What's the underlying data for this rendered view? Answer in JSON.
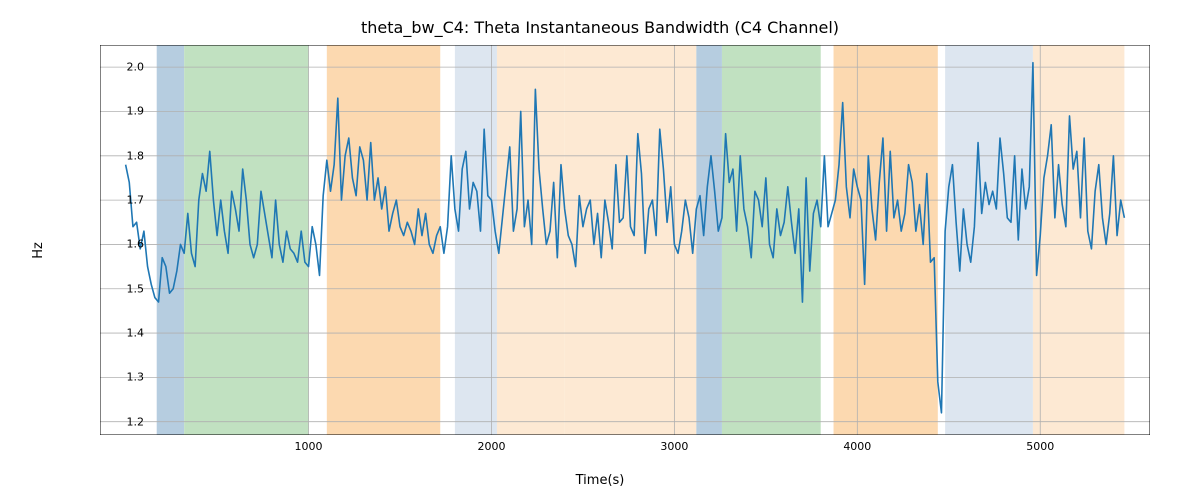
{
  "chart_data": {
    "type": "line",
    "title": "theta_bw_C4: Theta Instantaneous Bandwidth (C4 Channel)",
    "xlabel": "Time(s)",
    "ylabel": "Hz",
    "xlim": [
      -140,
      5600
    ],
    "ylim": [
      1.17,
      2.05
    ],
    "xticks": [
      1000,
      2000,
      3000,
      4000,
      5000
    ],
    "yticks": [
      1.2,
      1.3,
      1.4,
      1.5,
      1.6,
      1.7,
      1.8,
      1.9,
      2.0
    ],
    "bands": [
      {
        "x0": 170,
        "x1": 320,
        "color": "#b6cde0"
      },
      {
        "x0": 320,
        "x1": 1000,
        "color": "#c1e1c1"
      },
      {
        "x0": 1100,
        "x1": 1720,
        "color": "#fcd9b0"
      },
      {
        "x0": 1800,
        "x1": 2030,
        "color": "#dde6f0"
      },
      {
        "x0": 2030,
        "x1": 2400,
        "color": "#fde9d3"
      },
      {
        "x0": 2400,
        "x1": 3120,
        "color": "#fde9d3"
      },
      {
        "x0": 3120,
        "x1": 3260,
        "color": "#b6cde0"
      },
      {
        "x0": 3260,
        "x1": 3800,
        "color": "#c1e1c1"
      },
      {
        "x0": 3870,
        "x1": 4440,
        "color": "#fcd9b0"
      },
      {
        "x0": 4480,
        "x1": 4960,
        "color": "#dde6f0"
      },
      {
        "x0": 4960,
        "x1": 5460,
        "color": "#fde9d3"
      }
    ],
    "x": [
      0,
      20,
      40,
      60,
      80,
      100,
      120,
      140,
      160,
      180,
      200,
      220,
      240,
      260,
      280,
      300,
      320,
      340,
      360,
      380,
      400,
      420,
      440,
      460,
      480,
      500,
      520,
      540,
      560,
      580,
      600,
      620,
      640,
      660,
      680,
      700,
      720,
      740,
      760,
      780,
      800,
      820,
      840,
      860,
      880,
      900,
      920,
      940,
      960,
      980,
      1000,
      1020,
      1040,
      1060,
      1080,
      1100,
      1120,
      1140,
      1160,
      1180,
      1200,
      1220,
      1240,
      1260,
      1280,
      1300,
      1320,
      1340,
      1360,
      1380,
      1400,
      1420,
      1440,
      1460,
      1480,
      1500,
      1520,
      1540,
      1560,
      1580,
      1600,
      1620,
      1640,
      1660,
      1680,
      1700,
      1720,
      1740,
      1760,
      1780,
      1800,
      1820,
      1840,
      1860,
      1880,
      1900,
      1920,
      1940,
      1960,
      1980,
      2000,
      2020,
      2040,
      2060,
      2080,
      2100,
      2120,
      2140,
      2160,
      2180,
      2200,
      2220,
      2240,
      2260,
      2280,
      2300,
      2320,
      2340,
      2360,
      2380,
      2400,
      2420,
      2440,
      2460,
      2480,
      2500,
      2520,
      2540,
      2560,
      2580,
      2600,
      2620,
      2640,
      2660,
      2680,
      2700,
      2720,
      2740,
      2760,
      2780,
      2800,
      2820,
      2840,
      2860,
      2880,
      2900,
      2920,
      2940,
      2960,
      2980,
      3000,
      3020,
      3040,
      3060,
      3080,
      3100,
      3120,
      3140,
      3160,
      3180,
      3200,
      3220,
      3240,
      3260,
      3280,
      3300,
      3320,
      3340,
      3360,
      3380,
      3400,
      3420,
      3440,
      3460,
      3480,
      3500,
      3520,
      3540,
      3560,
      3580,
      3600,
      3620,
      3640,
      3660,
      3680,
      3700,
      3720,
      3740,
      3760,
      3780,
      3800,
      3820,
      3840,
      3860,
      3880,
      3900,
      3920,
      3940,
      3960,
      3980,
      4000,
      4020,
      4040,
      4060,
      4080,
      4100,
      4120,
      4140,
      4160,
      4180,
      4200,
      4220,
      4240,
      4260,
      4280,
      4300,
      4320,
      4340,
      4360,
      4380,
      4400,
      4420,
      4440,
      4460,
      4480,
      4500,
      4520,
      4540,
      4560,
      4580,
      4600,
      4620,
      4640,
      4660,
      4680,
      4700,
      4720,
      4740,
      4760,
      4780,
      4800,
      4820,
      4840,
      4860,
      4880,
      4900,
      4920,
      4940,
      4960,
      4980,
      5000,
      5020,
      5040,
      5060,
      5080,
      5100,
      5120,
      5140,
      5160,
      5180,
      5200,
      5220,
      5240,
      5260,
      5280,
      5300,
      5320,
      5340,
      5360,
      5380,
      5400,
      5420,
      5440,
      5460
    ],
    "values": [
      1.78,
      1.74,
      1.64,
      1.65,
      1.59,
      1.63,
      1.55,
      1.51,
      1.48,
      1.47,
      1.57,
      1.55,
      1.49,
      1.5,
      1.54,
      1.6,
      1.58,
      1.67,
      1.58,
      1.55,
      1.7,
      1.76,
      1.72,
      1.81,
      1.7,
      1.62,
      1.7,
      1.63,
      1.58,
      1.72,
      1.68,
      1.63,
      1.77,
      1.7,
      1.6,
      1.57,
      1.6,
      1.72,
      1.67,
      1.62,
      1.57,
      1.7,
      1.6,
      1.56,
      1.63,
      1.59,
      1.58,
      1.56,
      1.63,
      1.56,
      1.55,
      1.64,
      1.6,
      1.53,
      1.71,
      1.79,
      1.72,
      1.78,
      1.93,
      1.7,
      1.8,
      1.84,
      1.75,
      1.71,
      1.82,
      1.79,
      1.7,
      1.83,
      1.7,
      1.75,
      1.68,
      1.73,
      1.63,
      1.67,
      1.7,
      1.64,
      1.62,
      1.65,
      1.63,
      1.6,
      1.68,
      1.62,
      1.67,
      1.6,
      1.58,
      1.62,
      1.64,
      1.58,
      1.64,
      1.8,
      1.68,
      1.63,
      1.77,
      1.81,
      1.68,
      1.74,
      1.72,
      1.63,
      1.86,
      1.71,
      1.7,
      1.63,
      1.58,
      1.66,
      1.74,
      1.82,
      1.63,
      1.68,
      1.9,
      1.64,
      1.7,
      1.6,
      1.95,
      1.77,
      1.68,
      1.6,
      1.63,
      1.74,
      1.57,
      1.78,
      1.68,
      1.62,
      1.6,
      1.55,
      1.71,
      1.64,
      1.68,
      1.7,
      1.6,
      1.67,
      1.57,
      1.7,
      1.65,
      1.59,
      1.78,
      1.65,
      1.66,
      1.8,
      1.64,
      1.62,
      1.85,
      1.76,
      1.58,
      1.68,
      1.7,
      1.62,
      1.86,
      1.77,
      1.65,
      1.73,
      1.6,
      1.58,
      1.63,
      1.7,
      1.66,
      1.58,
      1.68,
      1.71,
      1.62,
      1.73,
      1.8,
      1.72,
      1.63,
      1.66,
      1.85,
      1.74,
      1.77,
      1.63,
      1.8,
      1.68,
      1.64,
      1.57,
      1.72,
      1.7,
      1.64,
      1.75,
      1.6,
      1.57,
      1.68,
      1.62,
      1.65,
      1.73,
      1.65,
      1.58,
      1.68,
      1.47,
      1.75,
      1.54,
      1.67,
      1.7,
      1.64,
      1.8,
      1.64,
      1.67,
      1.7,
      1.78,
      1.92,
      1.73,
      1.66,
      1.77,
      1.73,
      1.7,
      1.51,
      1.8,
      1.68,
      1.61,
      1.74,
      1.84,
      1.63,
      1.81,
      1.66,
      1.7,
      1.63,
      1.67,
      1.78,
      1.74,
      1.63,
      1.69,
      1.6,
      1.76,
      1.56,
      1.57,
      1.29,
      1.22,
      1.63,
      1.73,
      1.78,
      1.65,
      1.54,
      1.68,
      1.6,
      1.56,
      1.64,
      1.83,
      1.67,
      1.74,
      1.69,
      1.72,
      1.68,
      1.84,
      1.76,
      1.66,
      1.65,
      1.8,
      1.61,
      1.77,
      1.68,
      1.73,
      2.01,
      1.53,
      1.62,
      1.75,
      1.8,
      1.87,
      1.66,
      1.78,
      1.69,
      1.64,
      1.89,
      1.77,
      1.81,
      1.66,
      1.84,
      1.63,
      1.59,
      1.72,
      1.78,
      1.66,
      1.6,
      1.67,
      1.8,
      1.62,
      1.7,
      1.66
    ]
  },
  "colors": {
    "line": "#1f77b4",
    "grid": "#b0b0b0",
    "spine": "#000000"
  }
}
